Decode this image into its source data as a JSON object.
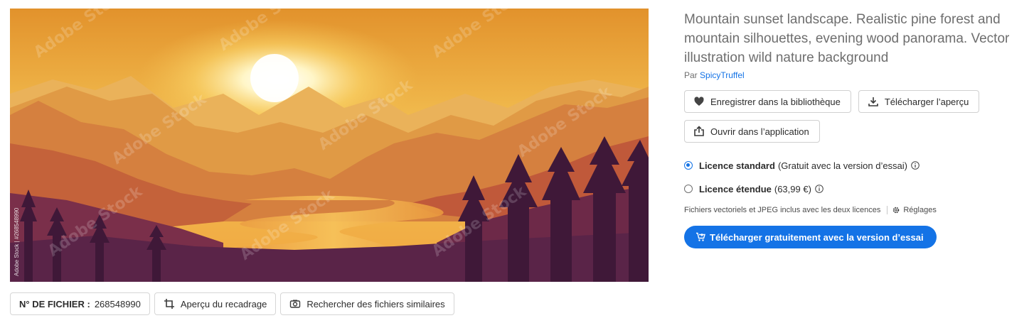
{
  "image": {
    "alt": "Mountain sunset landscape illustration",
    "watermark_text": "Adobe Stock | #268548990",
    "overlay_text": "Adobe Stock",
    "colors": {
      "sky_top": "#e59a2c",
      "sky_glow": "#fde07a",
      "far_mountains": "#e7a24a",
      "mid_mountains": "#d98640",
      "near_mountains": "#c5603a",
      "river": "#f2b44b",
      "forest_dark": "#5a2448",
      "forest_darkest": "#3f1838"
    }
  },
  "bottom_bar": {
    "file_label": "N° DE FICHIER :",
    "file_number": "268548990",
    "crop_preview": "Aperçu du recadrage",
    "find_similar": "Rechercher des fichiers similaires"
  },
  "details": {
    "title": "Mountain sunset landscape. Realistic pine forest and mountain silhouettes, evening wood panorama. Vector illustration wild nature background",
    "by_prefix": "Par",
    "author": "SpicyTruffel",
    "save_library": "Enregistrer dans la bibliothèque",
    "download_preview": "Télécharger l’aperçu",
    "open_in_app": "Ouvrir dans l’application"
  },
  "licences": {
    "standard_name": "Licence standard",
    "standard_detail": "(Gratuit avec la version d’essai)",
    "standard_selected": true,
    "extended_name": "Licence étendue",
    "extended_detail": "(63,99 €)",
    "extended_selected": false
  },
  "formats": {
    "note": "Fichiers vectoriels et JPEG inclus avec les deux licences",
    "settings": "Réglages"
  },
  "cta": {
    "label": "Télécharger gratuitement avec la version d’essai",
    "color": "#1473e6"
  },
  "icons": [
    "heart-icon",
    "download-icon",
    "open-in-app-icon",
    "info-icon",
    "gear-icon",
    "cart-icon",
    "crop-icon",
    "camera-icon"
  ]
}
